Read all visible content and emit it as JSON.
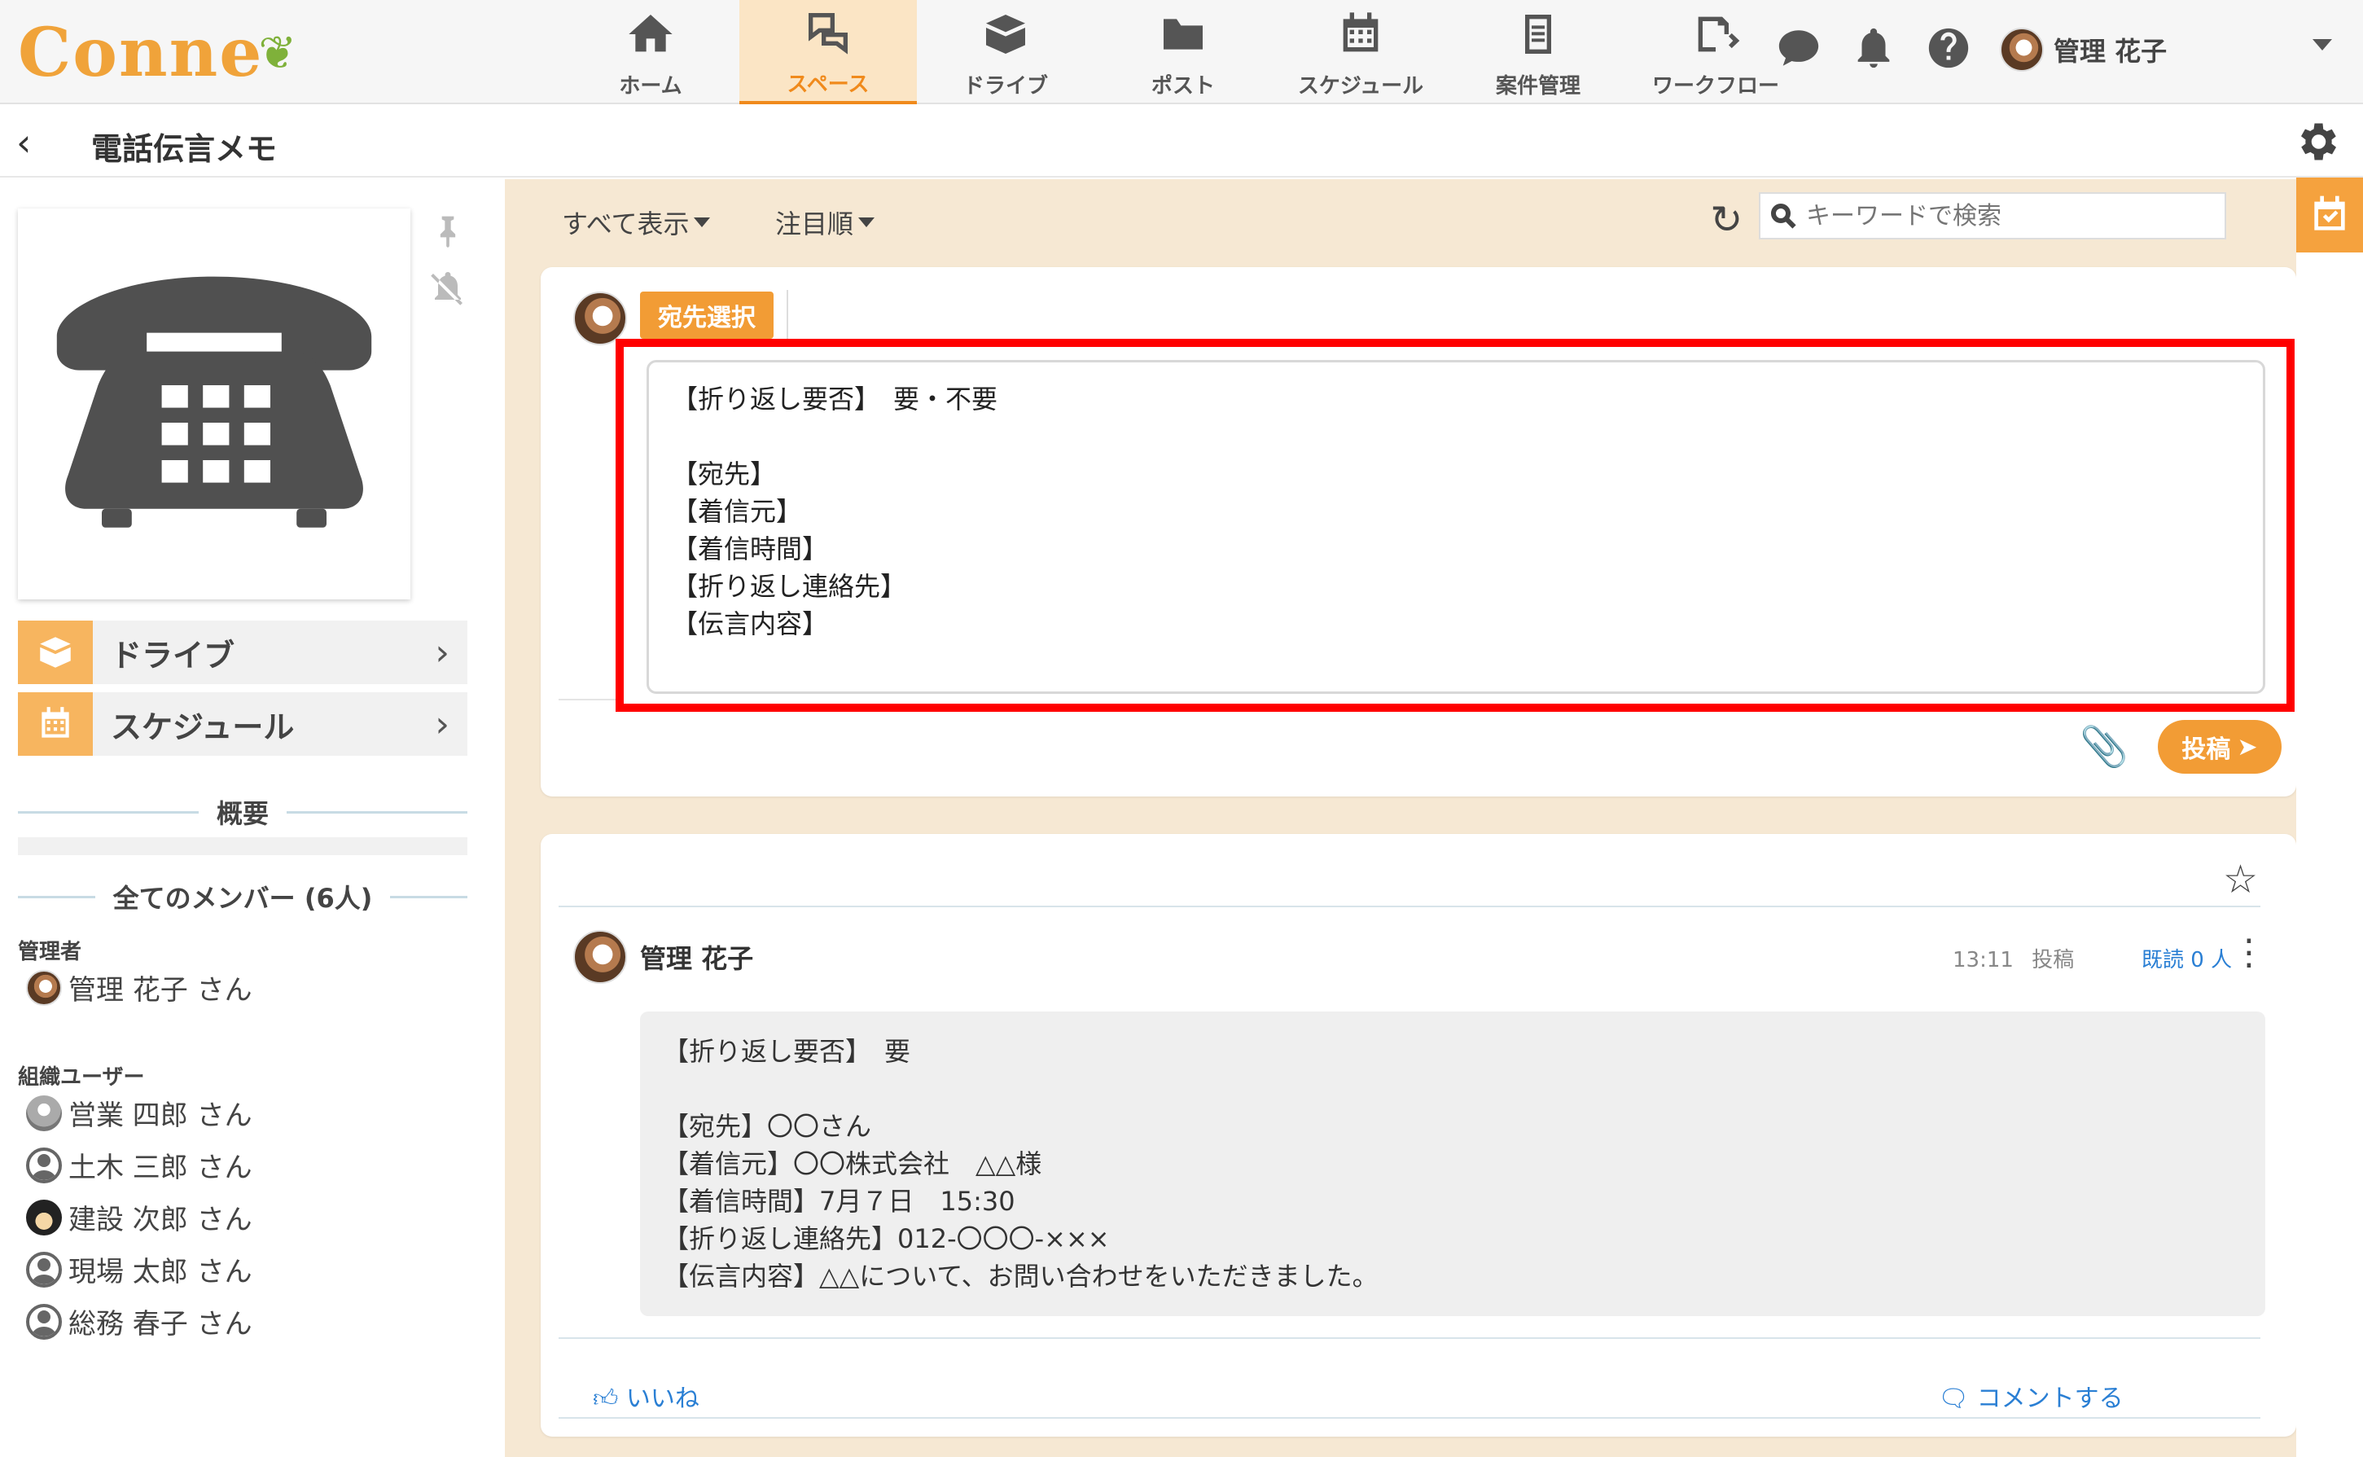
{
  "app": {
    "logo_text": "Conne"
  },
  "nav": {
    "items": [
      {
        "label": "ホーム",
        "icon": "home-icon"
      },
      {
        "label": "スペース",
        "icon": "space-icon"
      },
      {
        "label": "ドライブ",
        "icon": "drive-icon"
      },
      {
        "label": "ポスト",
        "icon": "post-icon"
      },
      {
        "label": "スケジュール",
        "icon": "calendar-icon"
      },
      {
        "label": "案件管理",
        "icon": "clipboard-icon"
      },
      {
        "label": "ワークフロー",
        "icon": "workflow-icon"
      }
    ],
    "active": "スペース"
  },
  "header": {
    "user_name": "管理 花子"
  },
  "page": {
    "title": "電話伝言メモ"
  },
  "sidebar": {
    "links": [
      {
        "label": "ドライブ",
        "icon": "drive-icon"
      },
      {
        "label": "スケジュール",
        "icon": "calendar-icon"
      }
    ],
    "summary_title": "概要",
    "members_title": "全てのメンバー (6人)",
    "admin_label": "管理者",
    "admins": [
      {
        "name": "管理 花子 さん"
      }
    ],
    "org_label": "組織ユーザー",
    "org_users": [
      {
        "name": "営業 四郎 さん"
      },
      {
        "name": "土木 三郎 さん"
      },
      {
        "name": "建設 次郎 さん"
      },
      {
        "name": "現場 太郎 さん"
      },
      {
        "name": "総務 春子 さん"
      }
    ]
  },
  "toolbar": {
    "filter_all": "すべて表示",
    "sort": "注目順",
    "search_placeholder": "キーワードで検索"
  },
  "composer": {
    "dest_button": "宛先選択",
    "text": "【折り返し要否】　要・不要\n\n【宛先】\n【着信元】\n【着信時間】\n【折り返し連絡先】\n【伝言内容】",
    "post_button": "投稿"
  },
  "post": {
    "author": "管理 花子",
    "time": "13:11",
    "posted_label": "投稿",
    "read": "既読 0 人",
    "body": "【折り返し要否】　要\n\n【宛先】〇〇さん\n【着信元】〇〇株式会社　△△様\n【着信時間】7月７日　15:30\n【折り返し連絡先】012-〇〇〇-×××\n【伝言内容】△△について、お問い合わせをいただきました。",
    "like": "いいね",
    "comment": "コメントする"
  },
  "colors": {
    "accent": "#f29c35",
    "highlight": "#ff0000",
    "main_bg": "#f6e8d3"
  }
}
